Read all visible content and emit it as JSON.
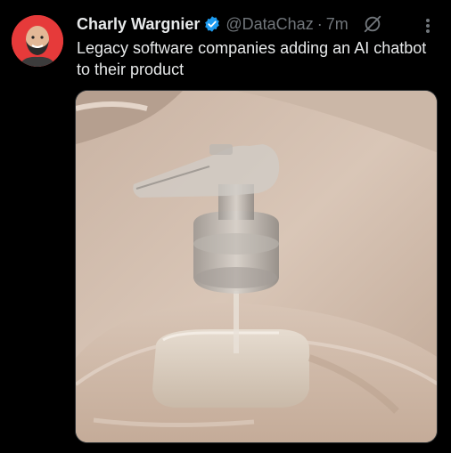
{
  "author": {
    "name": "Charly Wargnier",
    "handle": "@DataChaz",
    "separator": "·",
    "time": "7m"
  },
  "tweet": {
    "text": "Legacy software companies adding an AI chatbot to their product"
  },
  "icons": {
    "verified": "verified-badge-icon",
    "grok": "grok-icon",
    "more": "more-options-icon"
  },
  "colors": {
    "background": "#000000",
    "text_primary": "#e7e9ea",
    "text_secondary": "#71767b",
    "verified": "#1d9bf0",
    "avatar_bg": "#e63a3a"
  }
}
